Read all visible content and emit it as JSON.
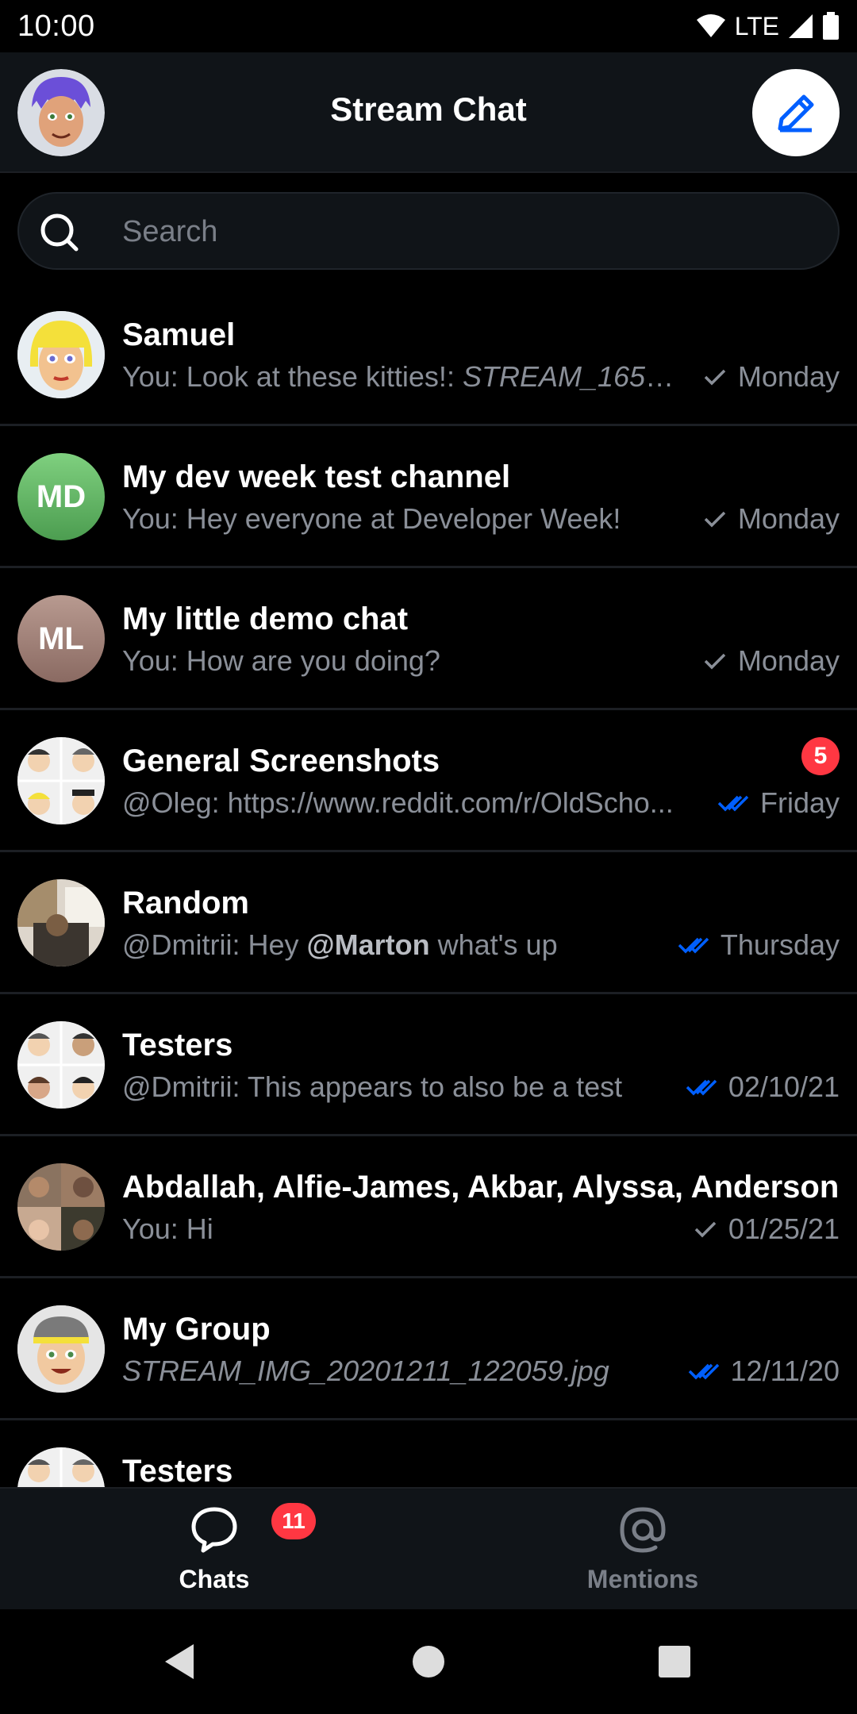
{
  "status_bar": {
    "time": "10:00",
    "network": "LTE"
  },
  "header": {
    "title": "Stream Chat",
    "avatar_icon": "user-avatar-cartoon",
    "compose_icon": "pencil-icon"
  },
  "search": {
    "placeholder": "Search"
  },
  "channels": [
    {
      "name": "Samuel",
      "preview_prefix": "You: Look at these kitties!: ",
      "preview_italic": "STREAM_1659...",
      "status": "sent",
      "date": "Monday"
    },
    {
      "name": "My dev week test channel",
      "initials": "MD",
      "preview": "You: Hey everyone at Developer Week!",
      "status": "sent",
      "date": "Monday"
    },
    {
      "name": "My little demo chat",
      "initials": "ML",
      "preview": "You: How are you doing?",
      "status": "sent",
      "date": "Monday"
    },
    {
      "name": "General Screenshots",
      "preview": "@Oleg: https://www.reddit.com/r/OldScho...",
      "status": "read",
      "date": "Friday",
      "unread": "5"
    },
    {
      "name": "Random",
      "preview_prefix": "@Dmitrii: Hey ",
      "preview_mention": "@Marton",
      "preview_suffix": " what's up",
      "status": "read",
      "date": "Thursday"
    },
    {
      "name": "Testers",
      "preview": "@Dmitrii: This appears to also be a test",
      "status": "read",
      "date": "02/10/21"
    },
    {
      "name": "Abdallah, Alfie-James, Akbar, Alyssa, Anderson",
      "preview": "You: Hi",
      "status": "sent",
      "date": "01/25/21"
    },
    {
      "name": "My Group",
      "preview_italic": "STREAM_IMG_20201211_122059.jpg",
      "status": "read",
      "date": "12/11/20"
    },
    {
      "name": "Testers"
    }
  ],
  "tabs": {
    "chats": {
      "label": "Chats",
      "badge": "11"
    },
    "mentions": {
      "label": "Mentions"
    }
  },
  "colors": {
    "accent": "#005fff",
    "badge": "#ff3742",
    "background": "#000000",
    "surface": "#101418",
    "secondary_text": "#8a8f98"
  }
}
